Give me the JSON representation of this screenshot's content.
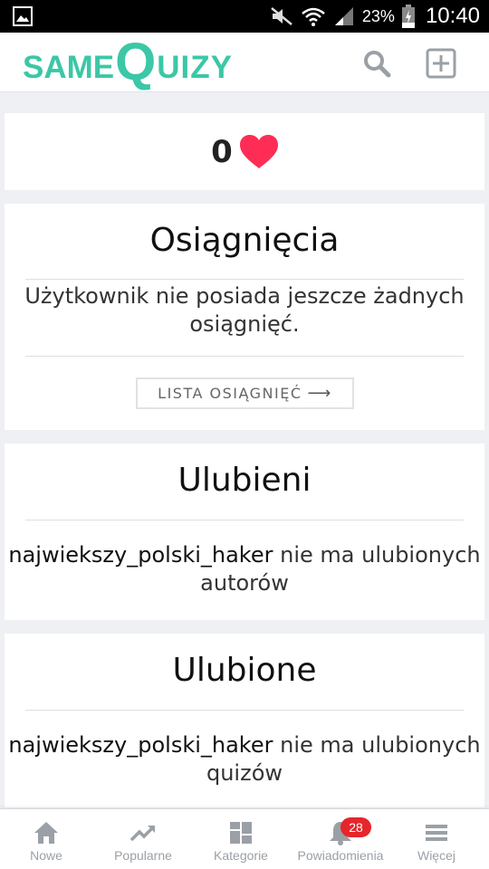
{
  "status_bar": {
    "battery_percent": "23%",
    "time": "10:40",
    "icons": [
      "gallery-icon",
      "mute-icon",
      "wifi-icon",
      "signal-icon",
      "battery-icon"
    ]
  },
  "header": {
    "logo_same": "SAME",
    "logo_q": "Q",
    "logo_uizy": "UIZY",
    "brand_color": "#3cc7a6",
    "icons": [
      "search-icon",
      "add-icon"
    ]
  },
  "likes": {
    "count": "0",
    "icon": "heart-icon",
    "heart_color": "#ff2d55"
  },
  "achievements": {
    "title": "Osiągnięcia",
    "message": "Użytkownik nie posiada jeszcze żadnych osiągnięć.",
    "button_label": "LISTA OSIĄGNIĘĆ",
    "button_arrow": "⟶"
  },
  "favorite_authors": {
    "title": "Ulubieni",
    "username": "najwiekszy_polski_haker",
    "message_rest": " nie ma ulubionych autorów"
  },
  "favorite_quizzes": {
    "title": "Ulubione",
    "username": "najwiekszy_polski_haker",
    "message_rest": " nie ma ulubionych quizów"
  },
  "bottom_nav": {
    "items": [
      {
        "label": "Nowe",
        "icon": "home-icon"
      },
      {
        "label": "Popularne",
        "icon": "trending-icon"
      },
      {
        "label": "Kategorie",
        "icon": "grid-icon"
      },
      {
        "label": "Powiadomienia",
        "icon": "bell-icon"
      },
      {
        "label": "Więcej",
        "icon": "menu-icon"
      }
    ],
    "notifications_badge": "28",
    "badge_color": "#e5262c"
  }
}
